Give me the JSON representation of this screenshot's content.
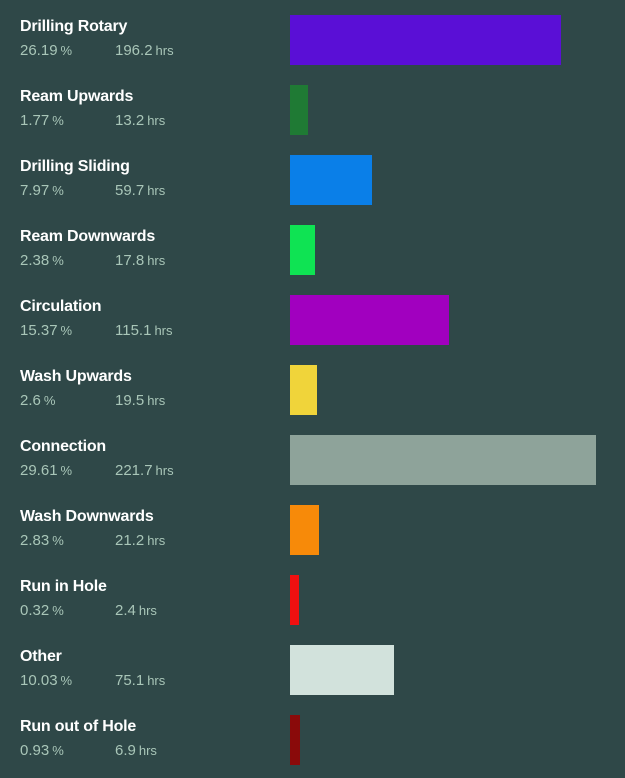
{
  "chart_data": {
    "type": "bar",
    "orientation": "horizontal",
    "percent_unit": "%",
    "hours_unit": "hrs",
    "max_value": 221.7,
    "items": [
      {
        "name": "Drilling Rotary",
        "percent": "26.19",
        "hours": 196.2,
        "color": "#5a0fd6"
      },
      {
        "name": "Ream Upwards",
        "percent": "1.77",
        "hours": 13.2,
        "color": "#1f7a34"
      },
      {
        "name": "Drilling Sliding",
        "percent": "7.97",
        "hours": 59.7,
        "color": "#0a7fe8"
      },
      {
        "name": "Ream Downwards",
        "percent": "2.38",
        "hours": 17.8,
        "color": "#0fe353"
      },
      {
        "name": "Circulation",
        "percent": "15.37",
        "hours": 115.1,
        "color": "#a100bf"
      },
      {
        "name": "Wash Upwards",
        "percent": "2.6",
        "hours": 19.5,
        "color": "#f0d43a"
      },
      {
        "name": "Connection",
        "percent": "29.61",
        "hours": 221.7,
        "color": "#8ea39a"
      },
      {
        "name": "Wash Downwards",
        "percent": "2.83",
        "hours": 21.2,
        "color": "#f78a09"
      },
      {
        "name": "Run in Hole",
        "percent": "0.32",
        "hours": 2.4,
        "color": "#f01010"
      },
      {
        "name": "Other",
        "percent": "10.03",
        "hours": 75.1,
        "color": "#d2e2dc"
      },
      {
        "name": "Run out of Hole",
        "percent": "0.93",
        "hours": 6.9,
        "color": "#8a0a0a"
      }
    ]
  }
}
